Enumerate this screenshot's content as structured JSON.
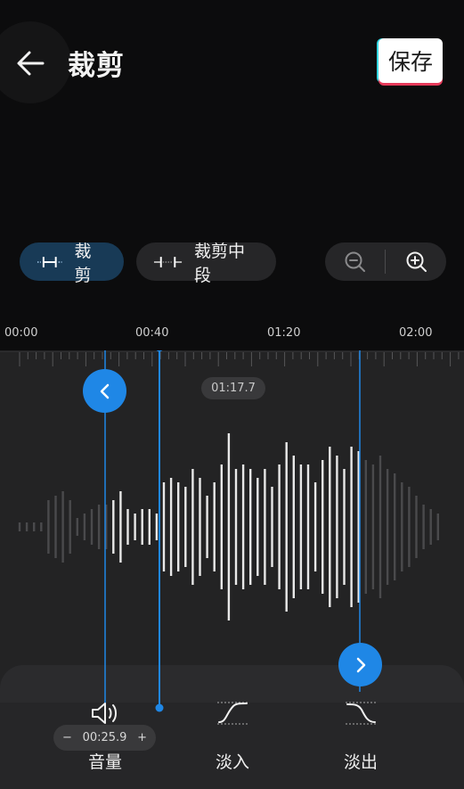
{
  "header": {
    "title": "裁剪",
    "save_label": "保存",
    "back_icon": "arrow-left-icon"
  },
  "modes": [
    {
      "label": "裁剪",
      "icon": "trim-icon",
      "active": true
    },
    {
      "label": "裁剪中段",
      "icon": "trim-middle-icon",
      "active": false
    }
  ],
  "zoom": {
    "out_icon": "zoom-out-icon",
    "in_icon": "zoom-in-icon"
  },
  "timeline": {
    "ticks": [
      "00:00",
      "00:40",
      "01:20",
      "02:00"
    ],
    "current_time": "01:17.7"
  },
  "tools": {
    "volume": {
      "label": "音量",
      "value": "00:25.9",
      "minus": "−",
      "plus": "+"
    },
    "fade_in": {
      "label": "淡入"
    },
    "fade_out": {
      "label": "淡出"
    }
  },
  "colors": {
    "accent": "#1f87e6",
    "background": "#0c0c0d",
    "track": "#232324",
    "active_chip": "#183a56"
  }
}
